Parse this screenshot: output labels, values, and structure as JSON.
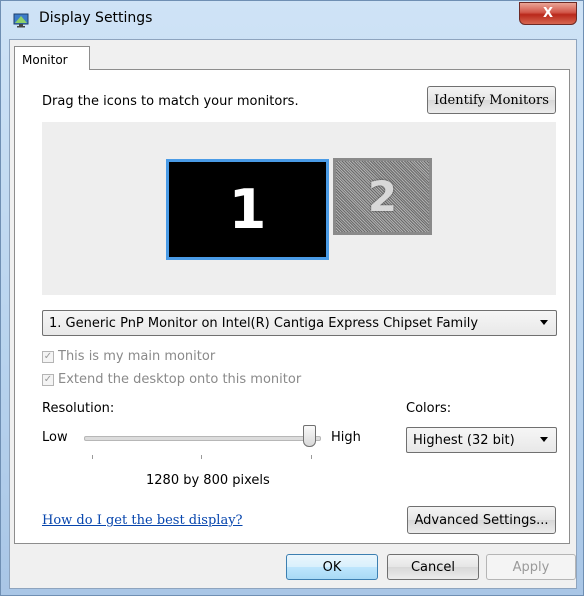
{
  "window": {
    "title": "Display Settings",
    "close_label": "X"
  },
  "tabs": [
    {
      "label": "Monitor",
      "selected": true
    }
  ],
  "monitor_tab": {
    "instruction": "Drag the icons to match your monitors.",
    "identify_button": "Identify Monitors",
    "monitors": [
      {
        "number": "1",
        "selected": true
      },
      {
        "number": "2",
        "selected": false
      }
    ],
    "monitor_select": {
      "selected": "1. Generic PnP Monitor on Intel(R) Cantiga Express Chipset Family"
    },
    "main_monitor_checkbox": {
      "label": "This is my main monitor",
      "checked": true,
      "enabled": false
    },
    "extend_checkbox": {
      "label": "Extend the desktop onto this monitor",
      "checked": true,
      "enabled": false
    },
    "resolution": {
      "label": "Resolution:",
      "low_label": "Low",
      "high_label": "High",
      "value_text": "1280 by 800 pixels",
      "slider_fraction": 0.96
    },
    "colors": {
      "label": "Colors:",
      "selected": "Highest (32 bit)"
    },
    "help_link": "How do I get the best display?",
    "advanced_button": "Advanced Settings..."
  },
  "footer": {
    "ok": "OK",
    "cancel": "Cancel",
    "apply": "Apply"
  },
  "colors": {
    "selection_border": "#4a9be6",
    "link": "#0645ad",
    "close_red": "#c8382a"
  }
}
